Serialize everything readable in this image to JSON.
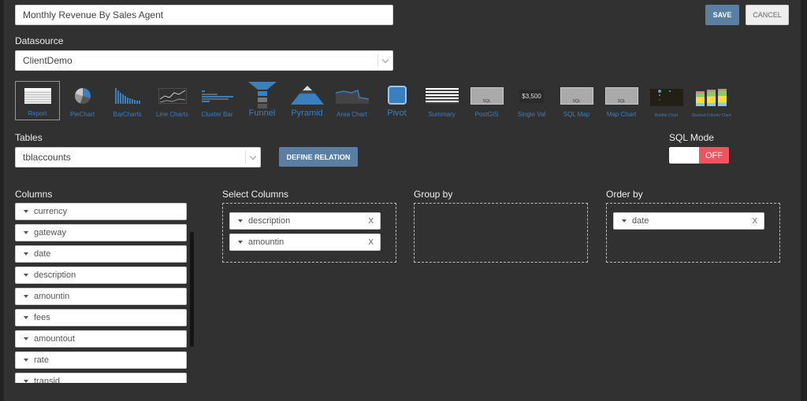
{
  "report_title": "Monthly Revenue By Sales Agent",
  "save_label": "SAVE",
  "cancel_label": "CANCEL",
  "datasource": {
    "label": "Datasource",
    "value": "ClientDemo"
  },
  "chart_types": [
    {
      "label": "Report",
      "icon": "report-icon",
      "selected": true
    },
    {
      "label": "PieChart",
      "icon": "pie-chart-icon"
    },
    {
      "label": "BarCharts",
      "icon": "bar-chart-icon"
    },
    {
      "label": "Line Charts",
      "icon": "line-chart-icon"
    },
    {
      "label": "Cluster Bar",
      "icon": "cluster-bar-icon"
    },
    {
      "label": "Funnel",
      "icon": "funnel-icon"
    },
    {
      "label": "Pyramid",
      "icon": "pyramid-icon"
    },
    {
      "label": "Area Chart",
      "icon": "area-chart-icon"
    },
    {
      "label": "Pivot",
      "icon": "pivot-icon"
    },
    {
      "label": "Summary",
      "icon": "summary-icon"
    },
    {
      "label": "PostGIS",
      "icon": "map-icon",
      "badge": "SQL"
    },
    {
      "label": "Single Val",
      "icon": "single-value-icon",
      "value": "$3,500"
    },
    {
      "label": "SQL Map",
      "icon": "map-icon",
      "badge": "SQL"
    },
    {
      "label": "Map Chart",
      "icon": "map-icon",
      "badge": "SQL"
    },
    {
      "label": "Bubble Chart",
      "icon": "bubble-chart-icon"
    },
    {
      "label": "Stacked Column Chart",
      "icon": "stacked-column-icon"
    }
  ],
  "tables": {
    "label": "Tables",
    "value": "tblaccounts"
  },
  "define_relation_label": "DEFINE RELATION",
  "sql_mode": {
    "label": "SQL Mode",
    "state": "OFF"
  },
  "columns": {
    "label": "Columns",
    "items": [
      "currency",
      "gateway",
      "date",
      "description",
      "amountin",
      "fees",
      "amountout",
      "rate",
      "transid"
    ]
  },
  "select_columns": {
    "label": "Select Columns",
    "items": [
      "description",
      "amountin"
    ]
  },
  "group_by": {
    "label": "Group by",
    "items": []
  },
  "order_by": {
    "label": "Order by",
    "items": [
      "date"
    ]
  },
  "remove_label": "X",
  "colors": {
    "accent": "#5a7fa3",
    "off": "#f0545f",
    "link": "#3a7fc0"
  }
}
